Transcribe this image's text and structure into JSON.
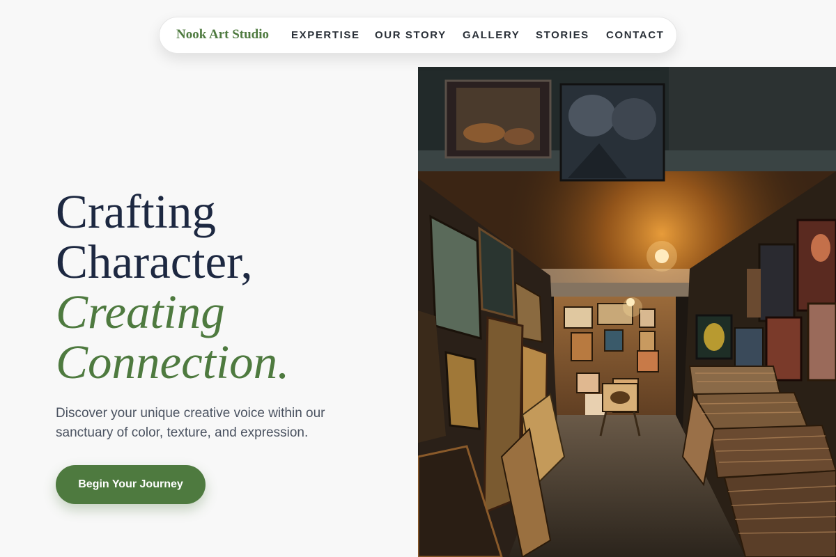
{
  "nav": {
    "brand": "Nook Art Studio",
    "links": [
      "EXPERTISE",
      "OUR STORY",
      "GALLERY",
      "STORIES",
      "CONTACT"
    ]
  },
  "hero": {
    "headline_line1": "Crafting",
    "headline_line2": "Character,",
    "headline_accent1": "Creating",
    "headline_accent2": "Connection.",
    "subtext": "Discover your unique creative voice within our sanctuary of color, texture, and expression.",
    "cta_label": "Begin Your Journey"
  },
  "colors": {
    "brand_green": "#4e7a3f",
    "headline_navy": "#1d2841",
    "background": "#f8f8f8"
  }
}
